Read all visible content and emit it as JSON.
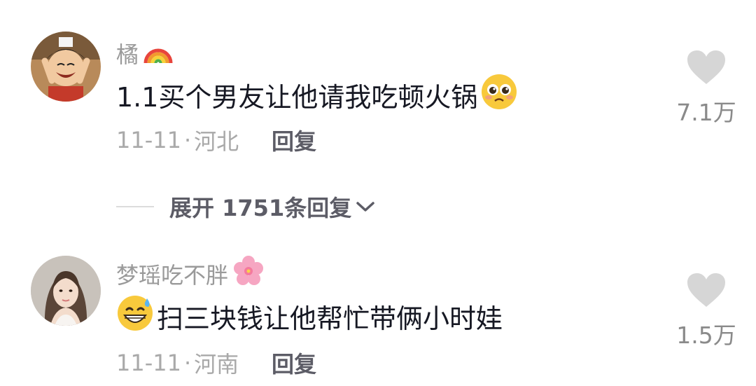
{
  "comments": [
    {
      "username": "橘",
      "username_emoji": "rainbow-icon",
      "text": "1.1买个男友让他请我吃顿火锅",
      "text_emoji": "pleading-face-icon",
      "date": "11-11",
      "separator": "·",
      "location": "河北",
      "reply_label": "回复",
      "like_count": "7.1万"
    },
    {
      "username": "梦瑶吃不胖",
      "username_emoji": "cherry-blossom-icon",
      "text": "扫三块钱让他帮忙带俩小时娃",
      "text_emoji": "grinning-sweat-face-icon",
      "date": "11-11",
      "separator": "·",
      "location": "河南",
      "reply_label": "回复",
      "like_count": "1.5万"
    }
  ],
  "expand_replies": {
    "label": "展开 1751条回复",
    "icon": "chevron-down-icon"
  },
  "colors": {
    "primary_text": "#161823",
    "secondary_text": "#9a9a9a",
    "reply_text": "#5c5c66",
    "heart": "#d6d6d6"
  }
}
